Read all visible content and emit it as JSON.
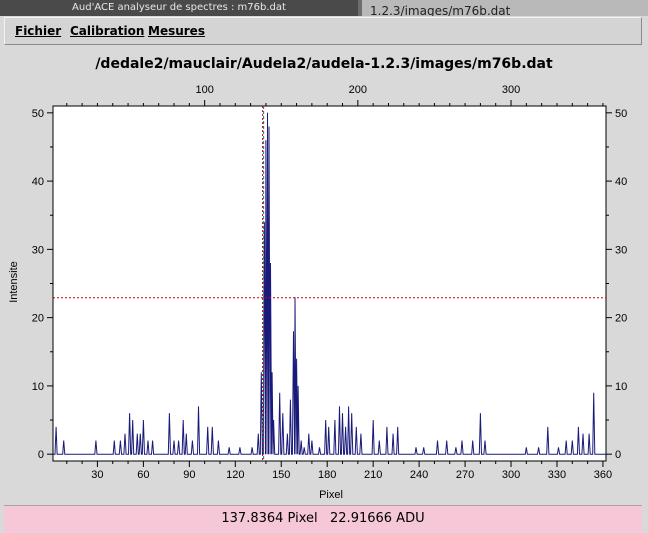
{
  "window": {
    "title": "Aud'ACE analyseur de spectres : m76b.dat",
    "other_tab": "1.2.3/images/m76b.dat"
  },
  "menu": {
    "fichier": "Fichier",
    "calibration": "Calibration",
    "mesures": "Mesures"
  },
  "status": {
    "pixel_text": "137.8364 Pixel",
    "adu_text": "22.91666 ADU"
  },
  "colors": {
    "series": "#1a1a7a",
    "cursor": "#cc0000",
    "marker": "#008080",
    "status_bg": "#f6c7d6"
  },
  "chart_data": {
    "type": "line",
    "title": "/dedale2/mauclair/Audela2/audela-1.2.3/images/m76b.dat",
    "xlabel": "Pixel",
    "ylabel": "Intensite",
    "xlim": [
      1,
      362
    ],
    "ylim": [
      -1,
      51
    ],
    "x_ticks": [
      30,
      60,
      90,
      120,
      150,
      180,
      210,
      240,
      270,
      300,
      330,
      360
    ],
    "x_top_ticks": [
      100,
      200,
      300
    ],
    "x_top_range": [
      1,
      362
    ],
    "y_ticks": [
      0,
      10,
      20,
      30,
      40,
      50
    ],
    "grid": false,
    "cursor": {
      "x": 137.8364,
      "y": 22.91666
    },
    "marker_x": 138.5,
    "peaks": [
      {
        "x": 3,
        "y": 4
      },
      {
        "x": 8,
        "y": 2
      },
      {
        "x": 29,
        "y": 2
      },
      {
        "x": 41,
        "y": 2
      },
      {
        "x": 45,
        "y": 2
      },
      {
        "x": 48,
        "y": 3
      },
      {
        "x": 51,
        "y": 6
      },
      {
        "x": 53,
        "y": 5
      },
      {
        "x": 56,
        "y": 3
      },
      {
        "x": 58,
        "y": 3
      },
      {
        "x": 60,
        "y": 5
      },
      {
        "x": 63,
        "y": 2
      },
      {
        "x": 66,
        "y": 2
      },
      {
        "x": 77,
        "y": 6
      },
      {
        "x": 80,
        "y": 2
      },
      {
        "x": 83,
        "y": 2
      },
      {
        "x": 86,
        "y": 5
      },
      {
        "x": 88,
        "y": 3
      },
      {
        "x": 92,
        "y": 2
      },
      {
        "x": 96,
        "y": 7
      },
      {
        "x": 102,
        "y": 4
      },
      {
        "x": 105,
        "y": 4
      },
      {
        "x": 109,
        "y": 2
      },
      {
        "x": 116,
        "y": 1
      },
      {
        "x": 123,
        "y": 1
      },
      {
        "x": 131,
        "y": 1
      },
      {
        "x": 135,
        "y": 3
      },
      {
        "x": 137,
        "y": 12
      },
      {
        "x": 139,
        "y": 34
      },
      {
        "x": 140,
        "y": 46
      },
      {
        "x": 141,
        "y": 50
      },
      {
        "x": 142,
        "y": 48
      },
      {
        "x": 143,
        "y": 28
      },
      {
        "x": 144,
        "y": 12
      },
      {
        "x": 145,
        "y": 5
      },
      {
        "x": 149,
        "y": 9
      },
      {
        "x": 151,
        "y": 6
      },
      {
        "x": 154,
        "y": 3
      },
      {
        "x": 156,
        "y": 8
      },
      {
        "x": 158,
        "y": 18
      },
      {
        "x": 159,
        "y": 23
      },
      {
        "x": 160,
        "y": 14
      },
      {
        "x": 161,
        "y": 10
      },
      {
        "x": 163,
        "y": 2
      },
      {
        "x": 165,
        "y": 1
      },
      {
        "x": 168,
        "y": 3
      },
      {
        "x": 170,
        "y": 2
      },
      {
        "x": 175,
        "y": 1
      },
      {
        "x": 179,
        "y": 5
      },
      {
        "x": 181,
        "y": 4
      },
      {
        "x": 185,
        "y": 5
      },
      {
        "x": 188,
        "y": 7
      },
      {
        "x": 190,
        "y": 6
      },
      {
        "x": 192,
        "y": 4
      },
      {
        "x": 194,
        "y": 7
      },
      {
        "x": 196,
        "y": 6
      },
      {
        "x": 199,
        "y": 4
      },
      {
        "x": 202,
        "y": 3
      },
      {
        "x": 210,
        "y": 5
      },
      {
        "x": 214,
        "y": 2
      },
      {
        "x": 219,
        "y": 4
      },
      {
        "x": 223,
        "y": 3
      },
      {
        "x": 226,
        "y": 4
      },
      {
        "x": 238,
        "y": 1
      },
      {
        "x": 243,
        "y": 1
      },
      {
        "x": 252,
        "y": 2
      },
      {
        "x": 258,
        "y": 2
      },
      {
        "x": 264,
        "y": 1
      },
      {
        "x": 268,
        "y": 2
      },
      {
        "x": 275,
        "y": 2
      },
      {
        "x": 280,
        "y": 6
      },
      {
        "x": 283,
        "y": 2
      },
      {
        "x": 310,
        "y": 1
      },
      {
        "x": 318,
        "y": 1
      },
      {
        "x": 324,
        "y": 4
      },
      {
        "x": 331,
        "y": 1
      },
      {
        "x": 336,
        "y": 2
      },
      {
        "x": 340,
        "y": 2
      },
      {
        "x": 344,
        "y": 4
      },
      {
        "x": 347,
        "y": 3
      },
      {
        "x": 351,
        "y": 3
      },
      {
        "x": 354,
        "y": 9
      }
    ]
  }
}
